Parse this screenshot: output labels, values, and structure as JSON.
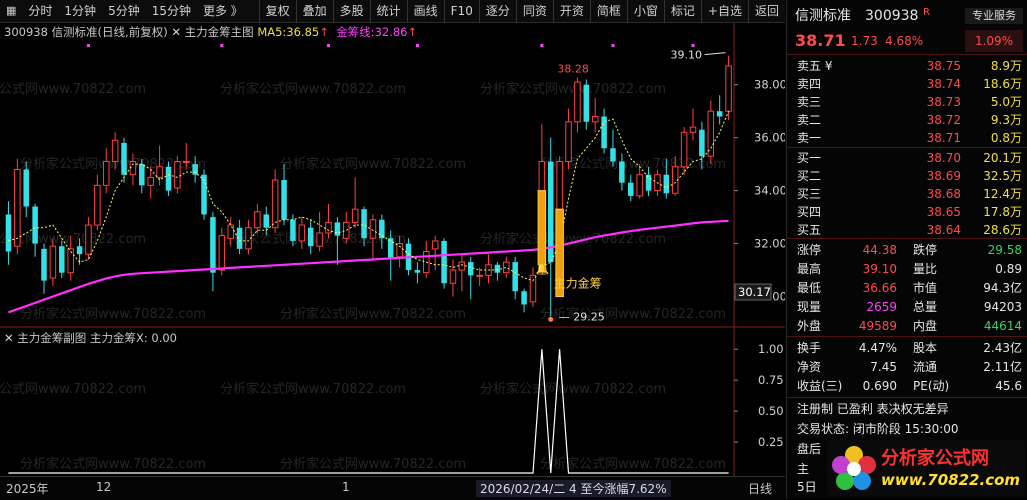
{
  "toolbar": {
    "left": [
      "分时",
      "1分钟",
      "5分钟",
      "15分钟",
      "更多 》"
    ],
    "right": [
      "复权",
      "叠加",
      "多股",
      "统计",
      "画线",
      "F10",
      "逐分",
      "同资",
      "开资",
      "简框",
      "小窗",
      "标记",
      "+自选",
      "返回"
    ]
  },
  "legend": {
    "code": "300938",
    "name": "信测标准(日线,前复权)",
    "indicator": "主力金筹主图",
    "ma5_label": "MA5:",
    "ma5_value": "36.85",
    "ma5_arrow": "↑",
    "jc_label": "金筹线:",
    "jc_value": "32.86",
    "jc_arrow": "↑"
  },
  "sublegend": {
    "indicator": "主力金筹副图",
    "x_label": "主力金筹X:",
    "x_value": "0.00"
  },
  "annotations": {
    "high_label": "39.10",
    "mid_high_label": "38.28",
    "low_label": "29.25",
    "signal_label": "主力金筹",
    "current_price_tag": "30.17"
  },
  "price_axis": [
    "38.00",
    "36.00",
    "34.00",
    "32.00",
    "30.00"
  ],
  "sub_axis": [
    "1.00",
    "0.75",
    "0.50",
    "0.25"
  ],
  "bottom_axis": {
    "year": "2025年",
    "m12": "12",
    "m1": "1",
    "cursor": "2026/02/24/二  4  至今涨幅7.62%",
    "period": "日线"
  },
  "quote": {
    "name": "信测标准",
    "code": "300938",
    "badge": "R",
    "pro_service": "专业服务",
    "price": "38.71",
    "change": "1.73",
    "change_pct": "4.68%",
    "pro_pct": "1.09%",
    "asks": [
      {
        "label": "卖五 ¥",
        "price": "38.75",
        "vol": "8.9万"
      },
      {
        "label": "卖四",
        "price": "38.74",
        "vol": "18.6万"
      },
      {
        "label": "卖三",
        "price": "38.73",
        "vol": "5.0万"
      },
      {
        "label": "卖二",
        "price": "38.72",
        "vol": "9.3万"
      },
      {
        "label": "卖一",
        "price": "38.71",
        "vol": "0.8万"
      }
    ],
    "bids": [
      {
        "label": "买一",
        "price": "38.70",
        "vol": "20.1万"
      },
      {
        "label": "买二",
        "price": "38.69",
        "vol": "32.5万"
      },
      {
        "label": "买三",
        "price": "38.68",
        "vol": "12.4万"
      },
      {
        "label": "买四",
        "price": "38.65",
        "vol": "17.8万"
      },
      {
        "label": "买五",
        "price": "38.64",
        "vol": "28.6万"
      }
    ],
    "stats": [
      {
        "l1": "涨停",
        "v1": "44.38",
        "l2": "跌停",
        "v2": "29.58"
      },
      {
        "l1": "最高",
        "v1": "39.10",
        "l2": "量比",
        "v2": "0.89"
      },
      {
        "l1": "最低",
        "v1": "36.66",
        "l2": "市值",
        "v2": "94.3亿"
      },
      {
        "l1": "现量",
        "v1": "2659",
        "l2": "总量",
        "v2": "94203"
      },
      {
        "l1": "外盘",
        "v1": "49589",
        "l2": "内盘",
        "v2": "44614"
      }
    ],
    "stats2": [
      {
        "l1": "换手",
        "v1": "4.47%",
        "l2": "股本",
        "v2": "2.43亿"
      },
      {
        "l1": "净资",
        "v1": "7.45",
        "l2": "流通",
        "v2": "2.11亿"
      },
      {
        "l1": "收益(三)",
        "v1": "0.690",
        "l2": "PE(动)",
        "v2": "45.6"
      }
    ],
    "info1": "注册制 已盈利 表决权无差异",
    "info2": "交易状态: 闭市阶段 15:30:00",
    "info3": "盘后",
    "info4": "主",
    "info5": "5日"
  },
  "watermark": {
    "brand": "分析家公式网",
    "url": "www.70822.com"
  },
  "chart_data": [
    {
      "type": "candlestick",
      "title": "主力金筹主图",
      "ylim": [
        29.0,
        39.5
      ],
      "y_ticks": [
        30,
        32,
        34,
        36,
        38
      ],
      "candles": [
        [
          33.1,
          31.7,
          33.6,
          31.2
        ],
        [
          31.9,
          34.8,
          35.2,
          31.6
        ],
        [
          34.8,
          33.4,
          35.1,
          33.0
        ],
        [
          33.4,
          32.0,
          33.5,
          31.5
        ],
        [
          31.8,
          30.6,
          32.0,
          30.1
        ],
        [
          30.7,
          31.9,
          32.2,
          30.4
        ],
        [
          31.9,
          30.9,
          32.1,
          30.7
        ],
        [
          30.9,
          31.8,
          32.3,
          30.6
        ],
        [
          31.9,
          31.6,
          32.2,
          31.2
        ],
        [
          31.6,
          32.7,
          33.0,
          31.4
        ],
        [
          32.7,
          34.2,
          34.6,
          32.5
        ],
        [
          34.2,
          35.1,
          35.6,
          33.9
        ],
        [
          35.1,
          35.9,
          36.2,
          34.8
        ],
        [
          35.8,
          34.6,
          36.0,
          34.3
        ],
        [
          34.6,
          35.1,
          35.4,
          34.2
        ],
        [
          35.0,
          34.2,
          35.2,
          33.9
        ],
        [
          34.2,
          34.5,
          34.9,
          33.7
        ],
        [
          34.5,
          34.9,
          35.7,
          34.2
        ],
        [
          34.9,
          34.0,
          35.1,
          33.8
        ],
        [
          34.1,
          35.1,
          35.3,
          33.9
        ],
        [
          35.1,
          35.1,
          35.8,
          34.8
        ],
        [
          35.0,
          34.6,
          35.3,
          34.3
        ],
        [
          34.6,
          33.1,
          34.8,
          32.9
        ],
        [
          33.0,
          30.9,
          33.2,
          30.2
        ],
        [
          31.0,
          32.3,
          32.6,
          30.8
        ],
        [
          32.2,
          32.7,
          33.0,
          31.9
        ],
        [
          32.6,
          31.8,
          32.9,
          31.6
        ],
        [
          31.8,
          32.6,
          32.9,
          31.6
        ],
        [
          32.6,
          33.2,
          33.5,
          32.4
        ],
        [
          33.1,
          32.6,
          33.4,
          32.3
        ],
        [
          32.6,
          34.4,
          34.8,
          32.4
        ],
        [
          34.4,
          32.9,
          35.0,
          32.7
        ],
        [
          32.9,
          32.1,
          33.1,
          31.9
        ],
        [
          32.1,
          32.7,
          33.0,
          31.8
        ],
        [
          32.6,
          31.9,
          32.9,
          31.6
        ],
        [
          31.9,
          32.4,
          33.2,
          31.7
        ],
        [
          32.4,
          32.8,
          33.5,
          32.2
        ],
        [
          32.8,
          32.3,
          33.0,
          31.2
        ],
        [
          32.2,
          32.8,
          33.2,
          32.0
        ],
        [
          32.8,
          33.3,
          34.5,
          32.6
        ],
        [
          33.3,
          32.2,
          33.4,
          31.9
        ],
        [
          32.2,
          32.9,
          33.1,
          31.4
        ],
        [
          32.9,
          32.2,
          33.1,
          31.8
        ],
        [
          32.2,
          31.4,
          32.5,
          30.6
        ],
        [
          31.5,
          32.0,
          32.3,
          31.1
        ],
        [
          32.0,
          31.0,
          32.2,
          30.8
        ],
        [
          31.0,
          30.9,
          31.3,
          30.5
        ],
        [
          30.9,
          31.7,
          32.1,
          30.7
        ],
        [
          31.8,
          32.1,
          32.3,
          31.0
        ],
        [
          32.1,
          30.5,
          32.2,
          30.3
        ],
        [
          30.5,
          31.0,
          31.4,
          30.0
        ],
        [
          31.0,
          31.3,
          31.6,
          30.2
        ],
        [
          31.3,
          30.8,
          31.5,
          29.9
        ],
        [
          30.8,
          30.8,
          31.1,
          30.4
        ],
        [
          30.8,
          31.2,
          31.6,
          30.5
        ],
        [
          31.2,
          30.9,
          31.3,
          30.6
        ],
        [
          30.9,
          31.3,
          31.5,
          30.7
        ],
        [
          31.3,
          30.2,
          31.5,
          29.9
        ],
        [
          30.2,
          29.7,
          30.3,
          29.4
        ],
        [
          29.8,
          30.8,
          31.1,
          29.6
        ],
        [
          31.0,
          35.1,
          36.5,
          30.9
        ],
        [
          35.1,
          31.3,
          36.0,
          29.25
        ],
        [
          31.3,
          35.1,
          35.3,
          31.2
        ],
        [
          35.1,
          36.6,
          37.1,
          34.8
        ],
        [
          36.6,
          38.1,
          38.28,
          36.2
        ],
        [
          38.0,
          36.6,
          38.2,
          36.3
        ],
        [
          36.6,
          36.8,
          37.5,
          36.2
        ],
        [
          36.8,
          35.6,
          37.1,
          35.4
        ],
        [
          35.6,
          35.1,
          36.3,
          34.9
        ],
        [
          35.1,
          34.3,
          35.4,
          34.0
        ],
        [
          34.3,
          33.8,
          34.6,
          33.6
        ],
        [
          33.8,
          34.6,
          35.0,
          33.7
        ],
        [
          34.6,
          34.0,
          34.9,
          33.8
        ],
        [
          34.0,
          34.6,
          34.8,
          33.8
        ],
        [
          34.6,
          33.9,
          35.2,
          33.7
        ],
        [
          33.9,
          34.9,
          35.3,
          33.8
        ],
        [
          34.9,
          36.2,
          36.4,
          34.6
        ],
        [
          36.2,
          36.4,
          37.1,
          35.9
        ],
        [
          36.3,
          35.3,
          36.6,
          34.8
        ],
        [
          35.3,
          37.0,
          37.4,
          35.0
        ],
        [
          37.0,
          36.8,
          37.6,
          36.5
        ],
        [
          37.0,
          38.71,
          39.1,
          36.66
        ]
      ],
      "ma5": [
        32.1,
        32.2,
        32.4,
        32.6,
        32.6,
        32.7,
        32.2,
        31.7,
        31.3,
        31.4,
        32.1,
        33.0,
        34.0,
        34.5,
        35.0,
        35.0,
        34.8,
        34.4,
        34.6,
        34.5,
        34.7,
        34.7,
        34.4,
        33.5,
        33.2,
        32.7,
        32.1,
        32.1,
        32.5,
        32.5,
        32.8,
        32.9,
        32.9,
        33.0,
        32.9,
        32.7,
        32.5,
        32.4,
        32.5,
        32.7,
        32.7,
        32.5,
        32.3,
        32.1,
        31.9,
        31.6,
        31.4,
        31.3,
        31.2,
        31.2,
        31.1,
        31.2,
        31.1,
        31.0,
        31.0,
        31.0,
        31.1,
        30.9,
        30.7,
        30.6,
        31.1,
        31.3,
        32.0,
        33.7,
        35.2,
        35.6,
        36.0,
        36.6,
        36.7,
        35.9,
        35.2,
        34.9,
        34.5,
        34.3,
        34.1,
        34.3,
        34.7,
        35.1,
        35.2,
        35.6,
        36.2,
        37.0
      ],
      "jc": [
        29.4,
        29.52,
        29.64,
        29.76,
        29.88,
        30.0,
        30.12,
        30.24,
        30.36,
        30.48,
        30.58,
        30.68,
        30.76,
        30.82,
        30.86,
        30.88,
        30.9,
        30.92,
        30.94,
        30.96,
        30.98,
        31.0,
        31.02,
        31.04,
        31.06,
        31.08,
        31.1,
        31.12,
        31.14,
        31.16,
        31.18,
        31.2,
        31.22,
        31.24,
        31.26,
        31.28,
        31.3,
        31.32,
        31.34,
        31.36,
        31.38,
        31.4,
        31.42,
        31.44,
        31.46,
        31.48,
        31.5,
        31.52,
        31.54,
        31.56,
        31.58,
        31.6,
        31.62,
        31.64,
        31.66,
        31.68,
        31.7,
        31.72,
        31.74,
        31.76,
        31.8,
        31.86,
        31.92,
        32.0,
        32.08,
        32.16,
        32.24,
        32.3,
        32.36,
        32.42,
        32.47,
        32.52,
        32.56,
        32.6,
        32.64,
        32.68,
        32.72,
        32.76,
        32.8,
        32.82,
        32.84,
        32.86
      ]
    },
    {
      "type": "line",
      "title": "主力金筹副图",
      "series": [
        {
          "name": "主力金筹X",
          "values": [
            0,
            0,
            0,
            0,
            0,
            0,
            0,
            0,
            0,
            0,
            0,
            0,
            0,
            0,
            0,
            0,
            0,
            0,
            0,
            0,
            0,
            0,
            0,
            0,
            0,
            0,
            0,
            0,
            0,
            0,
            0,
            0,
            0,
            0,
            0,
            0,
            0,
            0,
            0,
            0,
            0,
            0,
            0,
            0,
            0,
            0,
            0,
            0,
            0,
            0,
            0,
            0,
            0,
            0,
            0,
            0,
            0,
            0,
            0,
            0,
            1,
            0,
            1,
            0,
            0,
            0,
            0,
            0,
            0,
            0,
            0,
            0,
            0,
            0,
            0,
            0,
            0,
            0,
            0,
            0,
            0,
            0
          ]
        }
      ],
      "ylim": [
        0,
        1.05
      ],
      "y_ticks": [
        0.25,
        0.5,
        0.75,
        1.0
      ]
    }
  ]
}
